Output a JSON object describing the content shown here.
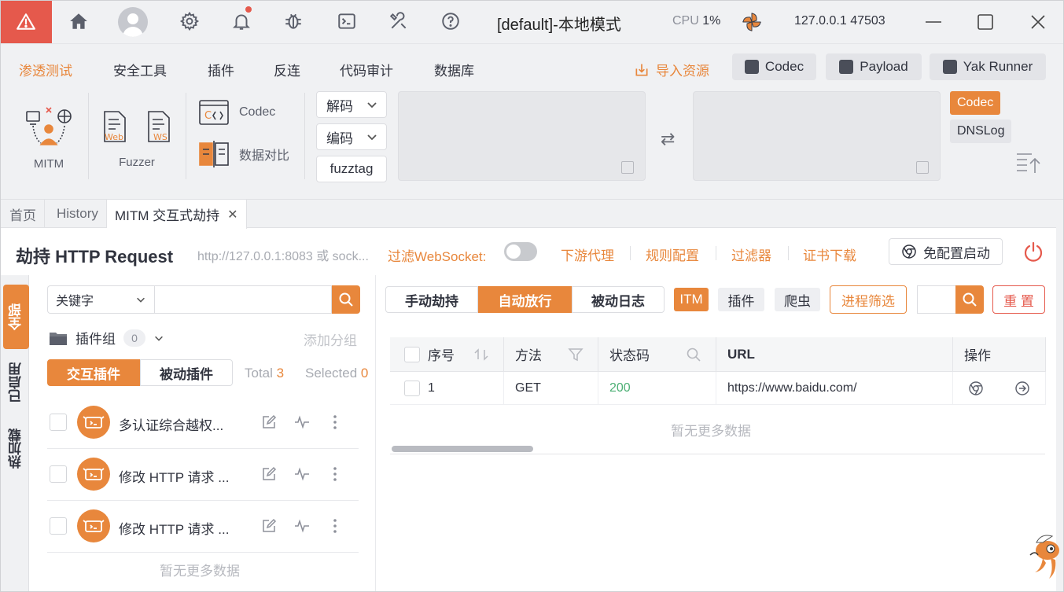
{
  "titlebar": {
    "title": "[default]-本地模式",
    "cpu_label": "CPU",
    "cpu_value": "1%",
    "ip": "127.0.0.1",
    "port": "47503"
  },
  "menu": {
    "items": [
      "渗透测试",
      "安全工具",
      "插件",
      "反连",
      "代码审计",
      "数据库"
    ],
    "active": "渗透测试",
    "import_label": "导入资源",
    "tool_buttons": [
      "Codec",
      "Payload",
      "Yak Runner"
    ]
  },
  "toolbox": {
    "mitm_label": "MITM",
    "fuzzer_label": "Fuzzer",
    "web_tag": "Web",
    "ws_tag": "WS",
    "codec_label": "Codec",
    "compare_label": "数据对比",
    "decode_label": "解码",
    "encode_label": "编码",
    "fuzztag_label": "fuzztag",
    "side_tags": [
      "Codec",
      "DNSLog"
    ]
  },
  "tabs": [
    {
      "label": "首页"
    },
    {
      "label": "History"
    },
    {
      "label": "MITM 交互式劫持",
      "closable": true,
      "active": true
    }
  ],
  "hijack": {
    "title": "劫持 HTTP Request",
    "address": "http://127.0.0.1:8083 或 sock...",
    "websocket_filter": "过滤WebSocket:",
    "websocket_filter_on": false,
    "links": [
      "下游代理",
      "规则配置",
      "过滤器",
      "证书下载"
    ],
    "no_config_button": "免配置启动"
  },
  "sidebar_tabs": [
    "全部",
    "已启用",
    "热加载"
  ],
  "plugins": {
    "search_mode": "关键字",
    "search_value": "",
    "group_label": "插件组",
    "group_count": "0",
    "add_group": "添加分组",
    "segments": [
      "交互插件",
      "被动插件"
    ],
    "total_label": "Total",
    "total_value": "3",
    "selected_label": "Selected",
    "selected_value": "0",
    "rows": [
      {
        "name": "多认证综合越权..."
      },
      {
        "name": "修改 HTTP 请求 ..."
      },
      {
        "name": "修改 HTTP 请求 ..."
      }
    ],
    "empty_text": "暂无更多数据"
  },
  "traffic": {
    "modes": [
      "手动劫持",
      "自动放行",
      "被动日志"
    ],
    "active_mode": "自动放行",
    "chips": [
      "ITM",
      "插件",
      "爬虫"
    ],
    "process_filter": "进程筛选",
    "reset_label": "重 置",
    "columns": [
      "序号",
      "方法",
      "状态码",
      "URL",
      "操作"
    ],
    "rows": [
      {
        "id": "1",
        "method": "GET",
        "status": "200",
        "url": "https://www.baidu.com/"
      }
    ],
    "empty_text": "暂无更多数据"
  },
  "colors": {
    "accent": "#e8873c",
    "danger": "#e5594c",
    "success": "#4caf74"
  }
}
